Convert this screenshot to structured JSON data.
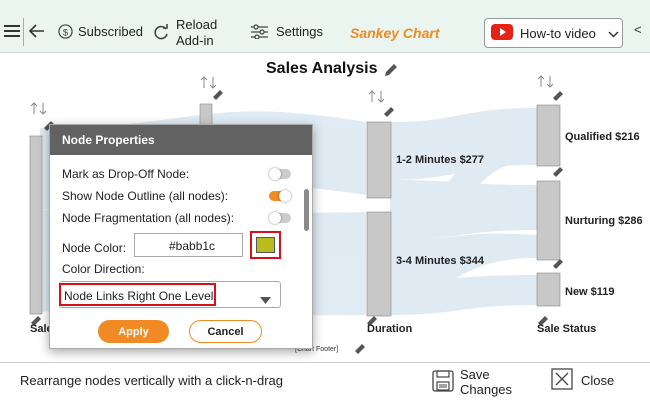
{
  "toolbar": {
    "subscribed_label": "Subscribed",
    "reload_line1": "Reload",
    "reload_line2": "Add-in",
    "settings_label": "Settings",
    "brand_label": "Sankey Chart",
    "howto_label": "How-to video",
    "side_arrow": "<"
  },
  "chart": {
    "title": "Sales Analysis",
    "footer": "[Chart Footer]"
  },
  "chart_data": {
    "type": "sankey",
    "title": "Sales Analysis",
    "columns": [
      "Sale",
      "Duration",
      "Sale Status"
    ],
    "nodes": [
      {
        "column": "Duration",
        "label": "1-2 Minutes",
        "value": 277
      },
      {
        "column": "Duration",
        "label": "3-4 Minutes",
        "value": 344
      },
      {
        "column": "Sale Status",
        "label": "Qualified",
        "value": 216
      },
      {
        "column": "Sale Status",
        "label": "Nurturing",
        "value": 286
      },
      {
        "column": "Sale Status",
        "label": "New",
        "value": 119
      }
    ],
    "node_labels": [
      "1-2 Minutes $277",
      "3-4 Minutes $344",
      "Qualified $216",
      "Nurturing $286",
      "New $119"
    ],
    "column_labels": [
      "Sale",
      "Duration",
      "Sale Status"
    ],
    "colors": {
      "node": "#c8c8c8",
      "link": "#dbe7f2"
    }
  },
  "dialog": {
    "title": "Node Properties",
    "drop_off_label": "Mark as Drop-Off Node:",
    "drop_off_on": false,
    "outline_label": "Show Node Outline (all nodes):",
    "outline_on": true,
    "fragmentation_label": "Node Fragmentation (all nodes):",
    "fragmentation_on": false,
    "node_color_label": "Node Color:",
    "node_color_value": "#babb1c",
    "swatch_color": "#babb1c",
    "color_direction_label": "Color Direction:",
    "color_direction_value": "Node Links Right One Level",
    "apply_label": "Apply",
    "cancel_label": "Cancel"
  },
  "status": {
    "hint": "Rearrange nodes vertically with a click-n-drag",
    "save_line1": "Save",
    "save_line2": "Changes",
    "close_label": "Close"
  },
  "colors": {
    "accent": "#f08a24",
    "toolbar_bg": "#e9f5ee",
    "highlight_border": "#d6111c"
  }
}
